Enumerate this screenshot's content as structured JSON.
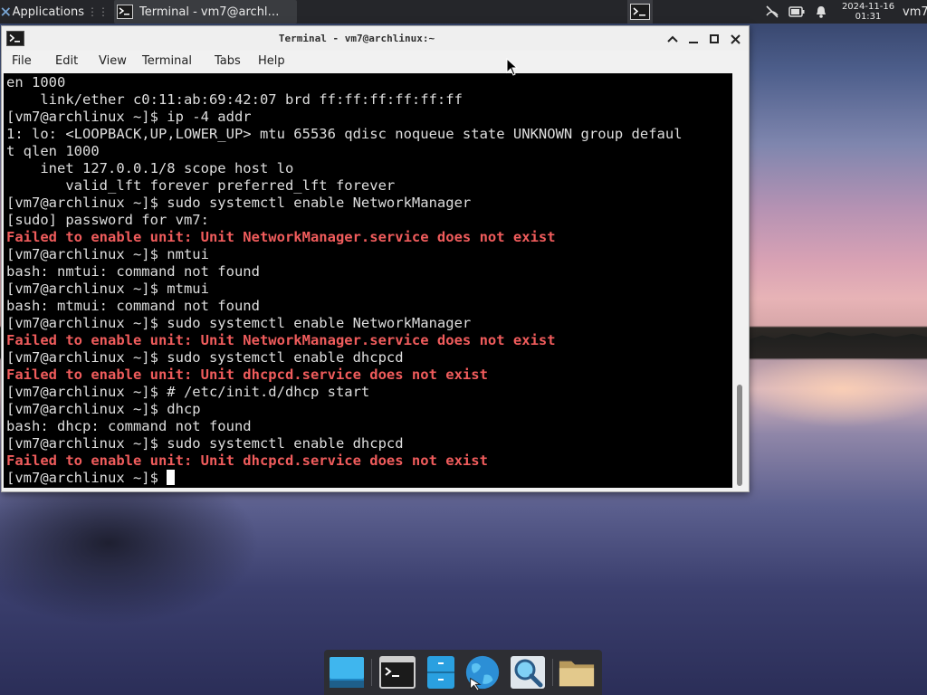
{
  "top_panel": {
    "apps_label": "Applications",
    "apps_separator": "⋮⋮",
    "task_title": "Terminal - vm7@archl…",
    "clock_date": "2024-11-16",
    "clock_time": "01:31",
    "user": "vm7"
  },
  "window": {
    "title": "Terminal - vm7@archlinux:~",
    "menu": [
      "File",
      "Edit",
      "View",
      "Terminal",
      "Tabs",
      "Help"
    ]
  },
  "terminal": {
    "lines": [
      {
        "text": "en 1000",
        "type": "out"
      },
      {
        "text": "    link/ether c0:11:ab:69:42:07 brd ff:ff:ff:ff:ff:ff",
        "type": "out"
      },
      {
        "text": "[vm7@archlinux ~]$ ip -4 addr",
        "type": "cmd"
      },
      {
        "text": "1: lo: <LOOPBACK,UP,LOWER_UP> mtu 65536 qdisc noqueue state UNKNOWN group defaul",
        "type": "out"
      },
      {
        "text": "t qlen 1000",
        "type": "out"
      },
      {
        "text": "    inet 127.0.0.1/8 scope host lo",
        "type": "out"
      },
      {
        "text": "       valid_lft forever preferred_lft forever",
        "type": "out"
      },
      {
        "text": "[vm7@archlinux ~]$ sudo systemctl enable NetworkManager",
        "type": "cmd"
      },
      {
        "text": "[sudo] password for vm7:",
        "type": "out"
      },
      {
        "text": "Failed to enable unit: Unit NetworkManager.service does not exist",
        "type": "err"
      },
      {
        "text": "[vm7@archlinux ~]$ nmtui",
        "type": "cmd"
      },
      {
        "text": "bash: nmtui: command not found",
        "type": "out"
      },
      {
        "text": "[vm7@archlinux ~]$ mtmui",
        "type": "cmd"
      },
      {
        "text": "bash: mtmui: command not found",
        "type": "out"
      },
      {
        "text": "[vm7@archlinux ~]$ sudo systemctl enable NetworkManager",
        "type": "cmd"
      },
      {
        "text": "Failed to enable unit: Unit NetworkManager.service does not exist",
        "type": "err"
      },
      {
        "text": "[vm7@archlinux ~]$ sudo systemctl enable dhcpcd",
        "type": "cmd"
      },
      {
        "text": "Failed to enable unit: Unit dhcpcd.service does not exist",
        "type": "err"
      },
      {
        "text": "[vm7@archlinux ~]$ # /etc/init.d/dhcp start",
        "type": "cmd"
      },
      {
        "text": "[vm7@archlinux ~]$ dhcp",
        "type": "cmd"
      },
      {
        "text": "bash: dhcp: command not found",
        "type": "out"
      },
      {
        "text": "[vm7@archlinux ~]$ sudo systemctl enable dhcpcd",
        "type": "cmd"
      },
      {
        "text": "Failed to enable unit: Unit dhcpcd.service does not exist",
        "type": "err"
      }
    ],
    "prompt": "[vm7@archlinux ~]$ "
  },
  "dock": [
    "show-desktop-icon",
    "terminal-icon",
    "file-manager-icon",
    "web-browser-icon",
    "app-finder-icon",
    "home-folder-icon"
  ],
  "colors": {
    "panel_bg": "#25262a",
    "terminal_bg": "#000000",
    "terminal_fg": "#dedede",
    "error_red": "#f05c5c"
  }
}
